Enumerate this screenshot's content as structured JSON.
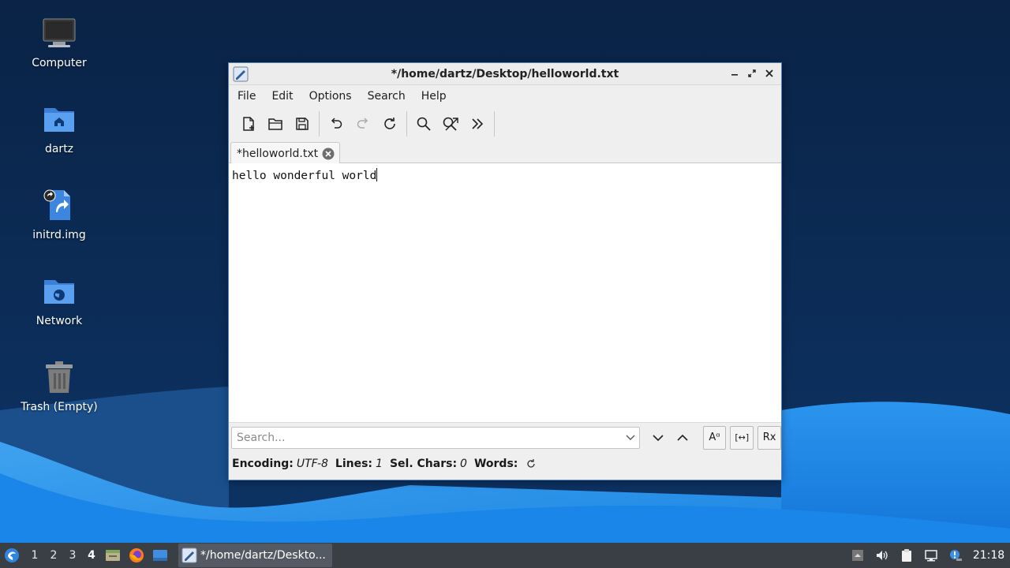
{
  "desktop": {
    "icons": [
      {
        "label": "Computer",
        "icon": "computer-icon"
      },
      {
        "label": "dartz",
        "icon": "home-folder-icon"
      },
      {
        "label": "initrd.img",
        "icon": "symlink-file-icon"
      },
      {
        "label": "Network",
        "icon": "network-folder-icon"
      },
      {
        "label": "Trash (Empty)",
        "icon": "trash-icon"
      }
    ]
  },
  "window": {
    "title": "*/home/dartz/Desktop/helloworld.txt",
    "menu": [
      "File",
      "Edit",
      "Options",
      "Search",
      "Help"
    ],
    "toolbar": [
      "new-file-icon",
      "open-file-icon",
      "save-icon",
      "undo-icon",
      "redo-icon",
      "reload-icon",
      "find-icon",
      "replace-icon",
      "more-icon"
    ],
    "tab": {
      "label": "*helloworld.txt"
    },
    "editor": {
      "text": "hello wonderful world"
    },
    "find": {
      "placeholder": "Search...",
      "case_label": "Aᵅ",
      "whole_word_label": "[↔]",
      "regex_label": "Rx"
    },
    "status": {
      "encoding_label": "Encoding:",
      "encoding_value": "UTF-8",
      "lines_label": "Lines:",
      "lines_value": "1",
      "selchars_label": "Sel. Chars:",
      "selchars_value": "0",
      "words_label": "Words:"
    }
  },
  "taskbar": {
    "workspaces": [
      "1",
      "2",
      "3",
      "4"
    ],
    "active_workspace": "4",
    "task_label": "*/home/dartz/Deskto...",
    "clock": "21:18"
  },
  "colors": {
    "desktop_dark": "#0b2a52",
    "wave_blue": "#1d8be8",
    "window_border": "#5a86b7",
    "taskbar": "#3a3f46"
  }
}
